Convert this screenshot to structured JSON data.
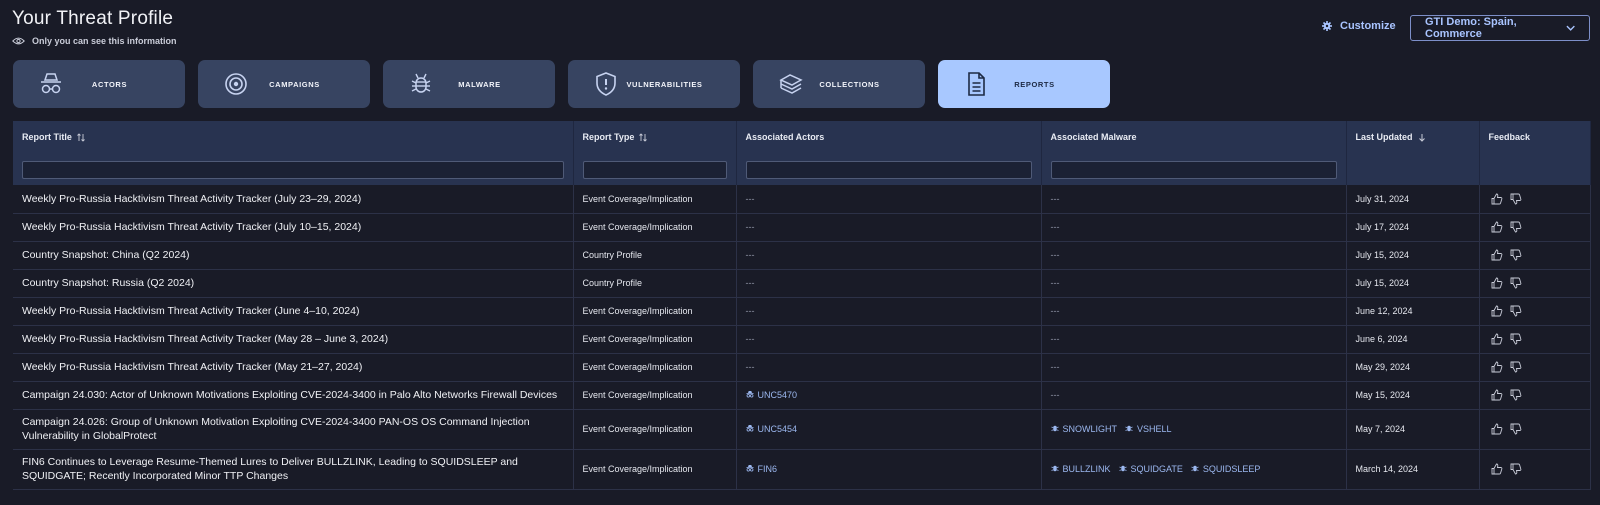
{
  "header": {
    "title": "Your Threat Profile",
    "privacy_note": "Only you can see this information",
    "customize_label": "Customize",
    "profile_select": "GTI Demo: Spain, Commerce"
  },
  "cards": [
    {
      "label": "ACTORS",
      "icon": "spy-icon",
      "active": false
    },
    {
      "label": "CAMPAIGNS",
      "icon": "target-icon",
      "active": false
    },
    {
      "label": "MALWARE",
      "icon": "bug-icon",
      "active": false
    },
    {
      "label": "VULNERABILITIES",
      "icon": "shield-alert-icon",
      "active": false
    },
    {
      "label": "COLLECTIONS",
      "icon": "stack-icon",
      "active": false
    },
    {
      "label": "REPORTS",
      "icon": "document-icon",
      "active": true
    }
  ],
  "table": {
    "columns": [
      "Report Title",
      "Report Type",
      "Associated Actors",
      "Associated Malware",
      "Last Updated",
      "Feedback"
    ],
    "filters": {
      "title": "",
      "type": "",
      "actors": "",
      "malware": ""
    },
    "rows": [
      {
        "title": "Weekly Pro-Russia Hacktivism Threat Activity Tracker (July 23–29, 2024)",
        "type": "Event Coverage/Implication",
        "actors": "---",
        "malware": "---",
        "updated": "July 31, 2024"
      },
      {
        "title": "Weekly Pro-Russia Hacktivism Threat Activity Tracker (July 10–15, 2024)",
        "type": "Event Coverage/Implication",
        "actors": "---",
        "malware": "---",
        "updated": "July 17, 2024"
      },
      {
        "title": "Country Snapshot: China (Q2 2024)",
        "type": "Country Profile",
        "actors": "---",
        "malware": "---",
        "updated": "July 15, 2024"
      },
      {
        "title": "Country Snapshot: Russia (Q2 2024)",
        "type": "Country Profile",
        "actors": "---",
        "malware": "---",
        "updated": "July 15, 2024"
      },
      {
        "title": "Weekly Pro-Russia Hacktivism Threat Activity Tracker (June 4–10, 2024)",
        "type": "Event Coverage/Implication",
        "actors": "---",
        "malware": "---",
        "updated": "June 12, 2024"
      },
      {
        "title": "Weekly Pro-Russia Hacktivism Threat Activity Tracker (May 28 – June 3, 2024)",
        "type": "Event Coverage/Implication",
        "actors": "---",
        "malware": "---",
        "updated": "June 6, 2024"
      },
      {
        "title": "Weekly Pro-Russia Hacktivism Threat Activity Tracker (May 21–27, 2024)",
        "type": "Event Coverage/Implication",
        "actors": "---",
        "malware": "---",
        "updated": "May 29, 2024"
      },
      {
        "title": "Campaign 24.030: Actor of Unknown Motivations Exploiting CVE-2024-3400 in Palo Alto Networks Firewall Devices",
        "type": "Event Coverage/Implication",
        "actors": [
          "UNC5470"
        ],
        "malware": "---",
        "updated": "May 15, 2024"
      },
      {
        "title": "Campaign 24.026: Group of Unknown Motivation Exploiting CVE-2024-3400 PAN-OS OS Command Injection Vulnerability in GlobalProtect",
        "type": "Event Coverage/Implication",
        "actors": [
          "UNC5454"
        ],
        "malware": [
          "SNOWLIGHT",
          "VSHELL"
        ],
        "updated": "May 7, 2024"
      },
      {
        "title": "FIN6 Continues to Leverage Resume-Themed Lures to Deliver BULLZLINK, Leading to SQUIDSLEEP and SQUIDGATE; Recently Incorporated Minor TTP Changes",
        "type": "Event Coverage/Implication",
        "actors": [
          "FIN6"
        ],
        "malware": [
          "BULLZLINK",
          "SQUIDGATE",
          "SQUIDSLEEP"
        ],
        "updated": "March 14, 2024"
      }
    ]
  }
}
